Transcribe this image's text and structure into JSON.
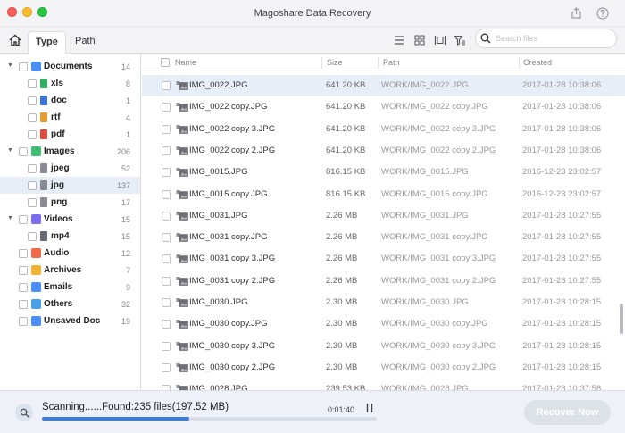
{
  "window": {
    "title": "Magoshare Data Recovery"
  },
  "tabs": [
    {
      "label": "Type",
      "active": true
    },
    {
      "label": "Path",
      "active": false
    }
  ],
  "search": {
    "placeholder": "Search files"
  },
  "tree": [
    {
      "label": "Documents",
      "count": "14",
      "level": 0,
      "expanded": true,
      "icon": "documents-icon",
      "color": "#4a8ff7"
    },
    {
      "label": "xls",
      "count": "8",
      "level": 1,
      "icon": "xls-file-icon",
      "color": "#2fae5d"
    },
    {
      "label": "doc",
      "count": "1",
      "level": 1,
      "icon": "doc-file-icon",
      "color": "#3c73d9"
    },
    {
      "label": "rtf",
      "count": "4",
      "level": 1,
      "icon": "rtf-file-icon",
      "color": "#e59b2f"
    },
    {
      "label": "pdf",
      "count": "1",
      "level": 1,
      "icon": "pdf-file-icon",
      "color": "#e04a3e"
    },
    {
      "label": "Images",
      "count": "206",
      "level": 0,
      "expanded": true,
      "icon": "images-icon",
      "color": "#3fbf73"
    },
    {
      "label": "jpeg",
      "count": "52",
      "level": 1,
      "icon": "jpeg-file-icon",
      "color": "#8a8a94"
    },
    {
      "label": "jpg",
      "count": "137",
      "level": 1,
      "icon": "jpg-file-icon",
      "color": "#8a8a94",
      "selected": true
    },
    {
      "label": "png",
      "count": "17",
      "level": 1,
      "icon": "png-file-icon",
      "color": "#8a8a94"
    },
    {
      "label": "Videos",
      "count": "15",
      "level": 0,
      "expanded": true,
      "icon": "videos-icon",
      "color": "#7b6cf0"
    },
    {
      "label": "mp4",
      "count": "15",
      "level": 1,
      "icon": "mp4-file-icon",
      "color": "#6a6a74"
    },
    {
      "label": "Audio",
      "count": "12",
      "level": 0,
      "icon": "audio-icon",
      "color": "#f06a4a"
    },
    {
      "label": "Archives",
      "count": "7",
      "level": 0,
      "icon": "archives-icon",
      "color": "#f2b233"
    },
    {
      "label": "Emails",
      "count": "9",
      "level": 0,
      "icon": "emails-icon",
      "color": "#4a8ff7"
    },
    {
      "label": "Others",
      "count": "32",
      "level": 0,
      "icon": "others-icon",
      "color": "#4aa0e8"
    },
    {
      "label": "Unsaved Doc",
      "count": "19",
      "level": 0,
      "icon": "unsaved-doc-icon",
      "color": "#4a8ff7"
    }
  ],
  "columns": {
    "name": "Name",
    "size": "Size",
    "path": "Path",
    "created": "Created"
  },
  "files": [
    {
      "name": "IMG_0022.JPG",
      "size": "641.20 KB",
      "path": "WORK/IMG_0022.JPG",
      "created": "2017-01-28 10:38:06",
      "selected": true
    },
    {
      "name": "IMG_0022 copy.JPG",
      "size": "641.20 KB",
      "path": "WORK/IMG_0022 copy.JPG",
      "created": "2017-01-28 10:38:06"
    },
    {
      "name": "IMG_0022 copy 3.JPG",
      "size": "641.20 KB",
      "path": "WORK/IMG_0022 copy 3.JPG",
      "created": "2017-01-28 10:38:06"
    },
    {
      "name": "IMG_0022 copy 2.JPG",
      "size": "641.20 KB",
      "path": "WORK/IMG_0022 copy 2.JPG",
      "created": "2017-01-28 10:38:06"
    },
    {
      "name": "IMG_0015.JPG",
      "size": "816.15 KB",
      "path": "WORK/IMG_0015.JPG",
      "created": "2016-12-23 23:02:57"
    },
    {
      "name": "IMG_0015 copy.JPG",
      "size": "816.15 KB",
      "path": "WORK/IMG_0015 copy.JPG",
      "created": "2016-12-23 23:02:57"
    },
    {
      "name": "IMG_0031.JPG",
      "size": "2.26 MB",
      "path": "WORK/IMG_0031.JPG",
      "created": "2017-01-28 10:27:55"
    },
    {
      "name": "IMG_0031 copy.JPG",
      "size": "2.26 MB",
      "path": "WORK/IMG_0031 copy.JPG",
      "created": "2017-01-28 10:27:55"
    },
    {
      "name": "IMG_0031 copy 3.JPG",
      "size": "2.26 MB",
      "path": "WORK/IMG_0031 copy 3.JPG",
      "created": "2017-01-28 10:27:55"
    },
    {
      "name": "IMG_0031 copy 2.JPG",
      "size": "2.26 MB",
      "path": "WORK/IMG_0031 copy 2.JPG",
      "created": "2017-01-28 10:27:55"
    },
    {
      "name": "IMG_0030.JPG",
      "size": "2.30 MB",
      "path": "WORK/IMG_0030.JPG",
      "created": "2017-01-28 10:28:15"
    },
    {
      "name": "IMG_0030 copy.JPG",
      "size": "2.30 MB",
      "path": "WORK/IMG_0030 copy.JPG",
      "created": "2017-01-28 10:28:15"
    },
    {
      "name": "IMG_0030 copy 3.JPG",
      "size": "2.30 MB",
      "path": "WORK/IMG_0030 copy 3.JPG",
      "created": "2017-01-28 10:28:15"
    },
    {
      "name": "IMG_0030 copy 2.JPG",
      "size": "2.30 MB",
      "path": "WORK/IMG_0030 copy 2.JPG",
      "created": "2017-01-28 10:28:15"
    },
    {
      "name": "IMG_0028.JPG",
      "size": "239.53 KB",
      "path": "WORK/IMG_0028.JPG",
      "created": "2017-01-28 10:37:58"
    }
  ],
  "status": {
    "scan_text": "Scanning......Found:235 files(197.52 MB)",
    "elapsed": "0:01:40",
    "progress": 0.44,
    "recover_label": "Recover Now"
  },
  "colors": {
    "accent": "#3b7ddd",
    "selection": "#e8eef8"
  }
}
